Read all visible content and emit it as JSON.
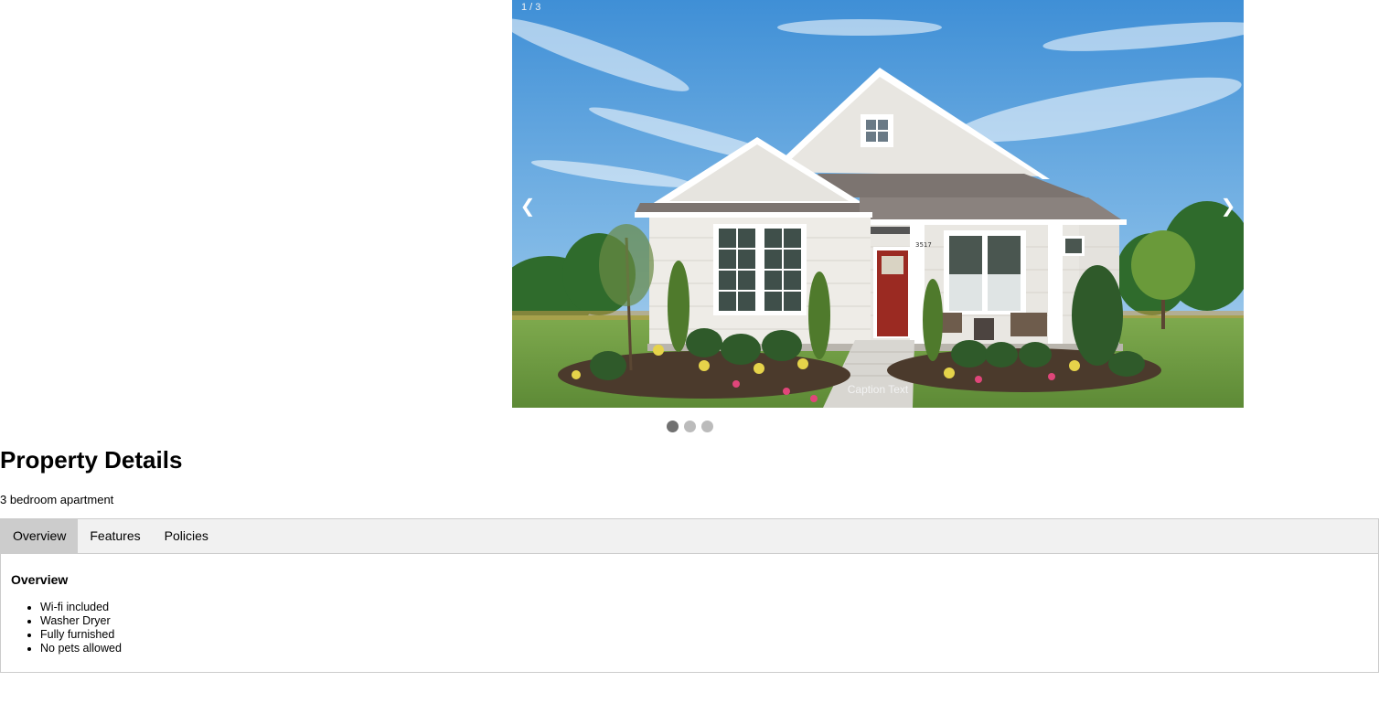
{
  "slideshow": {
    "counter": "1 / 3",
    "caption": "Caption Text",
    "prev_label": "❮",
    "next_label": "❯",
    "slide_count": 3,
    "active_slide": 1,
    "image_subject": "white single-story house with red front door and landscaped front yard",
    "house_number": "3517"
  },
  "details": {
    "title": "Property Details",
    "subtitle": "3 bedroom apartment"
  },
  "tabs": [
    {
      "label": "Overview",
      "active": true
    },
    {
      "label": "Features",
      "active": false
    },
    {
      "label": "Policies",
      "active": false
    }
  ],
  "panel": {
    "title": "Overview",
    "items": [
      "Wi-fi included",
      "Washer Dryer",
      "Fully furnished",
      "No pets allowed"
    ]
  },
  "colors": {
    "tab_bar_bg": "#f1f1f1",
    "tab_active_bg": "#cccccc",
    "dot_active": "#717171",
    "dot_inactive": "#bbbbbb",
    "door": "#9b2a22"
  }
}
